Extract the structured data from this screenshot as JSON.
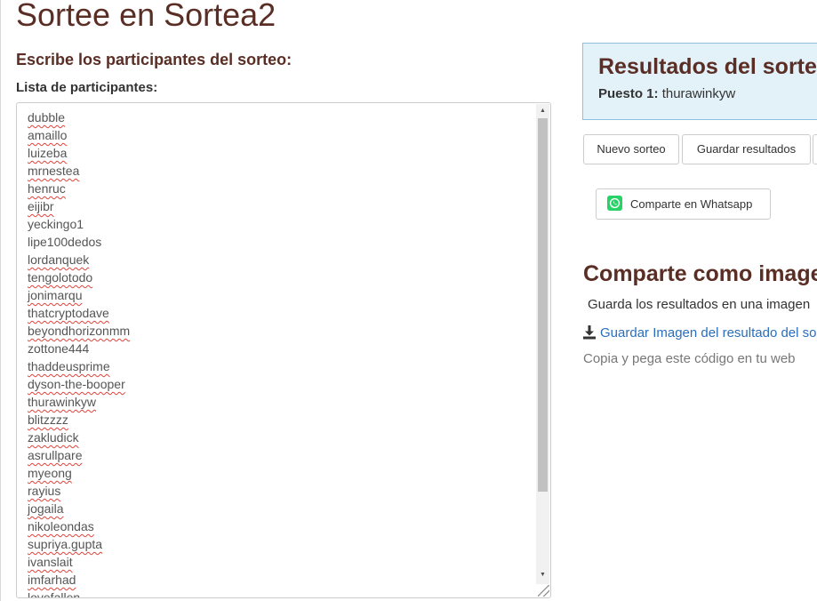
{
  "page": {
    "title": "Sortee en Sortea2",
    "subtitle": "Escribe los participantes del sorteo:",
    "list_label": "Lista de participantes:"
  },
  "participants": {
    "names": [
      "dubble",
      "amaillo",
      "luizeba",
      "mrnestea",
      "henruc",
      "eijibr",
      "yeckingo1",
      "lipe100dedos",
      "lordanquek",
      "tengolotodo",
      "jonimarqu",
      "thatcryptodave",
      "beyondhorizonmm",
      "zottone444",
      "thaddeusprime",
      "dyson-the-booper",
      "thurawinkyw",
      "blitzzzz",
      "zakludick",
      "asrullpare",
      "myeong",
      "rayius",
      "jogaila",
      "nikoleondas",
      "supriya.gupta",
      "ivanslait",
      "imfarhad",
      "lovefallen"
    ],
    "spellcheck_flagged": [
      true,
      true,
      true,
      true,
      true,
      true,
      false,
      false,
      true,
      true,
      true,
      true,
      true,
      false,
      true,
      true,
      true,
      true,
      true,
      true,
      true,
      true,
      true,
      true,
      true,
      true,
      true,
      true
    ]
  },
  "results": {
    "title": "Resultados del sorteo",
    "position_label": "Puesto 1:",
    "winner": "thurawinkyw"
  },
  "actions": {
    "new_draw": "Nuevo sorteo",
    "save_results": "Guardar resultados",
    "whatsapp": "Comparte en Whatsapp"
  },
  "share": {
    "title": "Comparte como imagen",
    "description": "Guarda los resultados en una imagen",
    "download_link": "Guardar Imagen del resultado del sorteo",
    "embed_text": "Copia y pega este código en tu web"
  },
  "icons": {
    "whatsapp": "whatsapp-icon",
    "download": "download-icon"
  },
  "colors": {
    "heading": "#5a2e25",
    "results_bg": "#e3f1f9",
    "results_border": "#8fc1dc",
    "link": "#2a6ebb",
    "whatsapp_green": "#25d366"
  }
}
